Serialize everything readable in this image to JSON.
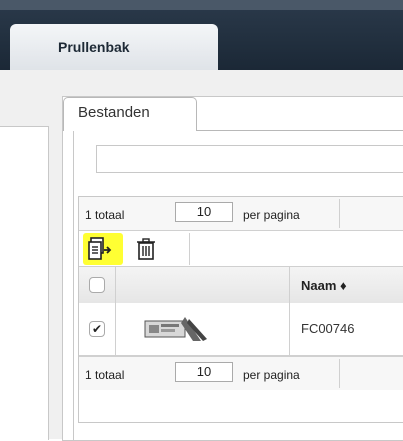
{
  "header": {
    "tab_label": "Prullenbak"
  },
  "panel": {
    "tab_label": "Bestanden"
  },
  "search": {
    "value": "",
    "placeholder": ""
  },
  "pager_top": {
    "total_text": "1 totaal",
    "per_page_value": "10",
    "per_page_label": "per pagina"
  },
  "toolbar": {
    "restore_icon": "restore-icon",
    "delete_icon": "trash-icon",
    "highlight_color": "#ffff33"
  },
  "table": {
    "header_select_checked": false,
    "columns": [
      "",
      "",
      "Naam ♦"
    ],
    "rows": [
      {
        "checked": true,
        "name": "FC00746"
      }
    ]
  },
  "pager_bottom": {
    "total_text": "1 totaal",
    "per_page_value": "10",
    "per_page_label": "per pagina"
  }
}
